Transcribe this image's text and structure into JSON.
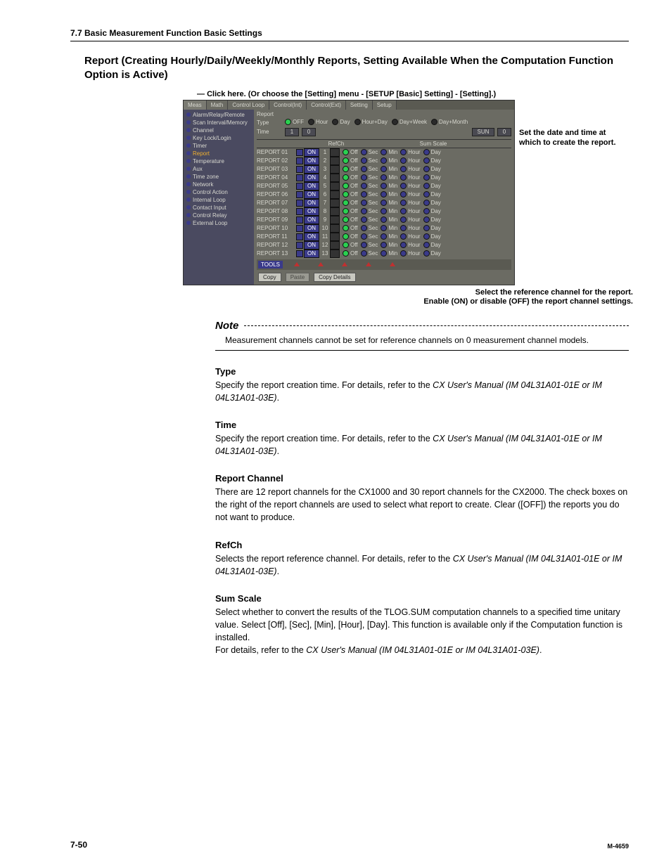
{
  "header": "7.7  Basic Measurement Function Basic Settings",
  "title": "Report (Creating Hourly/Daily/Weekly/Monthly Reports, Setting Available When the Computation Function Option is Active)",
  "click_here": "Click here. (Or choose the [Setting] menu - [SETUP [Basic] Setting] - [Setting].)",
  "right_annot": "Set the date and time at which to create the report.",
  "below_annot_1": "Select the reference channel for the report.",
  "below_annot_2": "Enable (ON) or disable (OFF) the report channel settings.",
  "note_head": "Note",
  "note_body": "Measurement channels cannot be set for reference channels on 0 measurement channel models.",
  "sect_type_h": "Type",
  "sect_type_p1": "Specify the report creation time. For details, refer to the ",
  "sect_type_it": "CX User's Manual (IM 04L31A01-01E or IM 04L31A01-03E)",
  "sect_type_p2": ".",
  "sect_time_h": "Time",
  "sect_time_p1": "Specify the report creation time.  For details, refer to the ",
  "sect_time_it": "CX User's Manual (IM 04L31A01-01E or IM 04L31A01-03E)",
  "sect_time_p2": ".",
  "sect_rc_h": "Report Channel",
  "sect_rc_p": "There are 12 report channels for the CX1000 and 30 report channels for the CX2000.  The check boxes on the right of the report channels are used to select what report to create.  Clear ([OFF]) the reports you do not want to produce.",
  "sect_ref_h": "RefCh",
  "sect_ref_p1": "Selects the report reference channel.  For details, refer to the ",
  "sect_ref_it": "CX User's Manual (IM 04L31A01-01E or IM 04L31A01-03E)",
  "sect_ref_p2": ".",
  "sect_sum_h": "Sum Scale",
  "sect_sum_p1": "Select whether to convert the results of the TLOG.SUM computation channels to a specified time unitary value.  Select [Off], [Sec], [Min], [Hour], [Day].  This function is available only if the Computation function is installed.",
  "sect_sum_p2a": "For details, refer to the ",
  "sect_sum_it": "CX User's Manual (IM 04L31A01-01E or IM 04L31A01-03E)",
  "sect_sum_p2b": ".",
  "page_num": "7-50",
  "manual_num": "M-4659",
  "shot": {
    "tabs": [
      "Meas",
      "Math",
      "Control Loop",
      "Control(Int)",
      "Control(Ext)",
      "Setting",
      "Setup"
    ],
    "active_tab": 0,
    "sidebar": [
      "Alarm/Relay/Remote",
      "Scan Interval/Memory",
      "Channel",
      "Key Lock/Login",
      "Timer",
      "Report",
      "Temperature",
      "Aux",
      "Time zone",
      "Network",
      "Control Action",
      "Internal Loop",
      "Contact Input",
      "Control Relay",
      "External Loop"
    ],
    "sidebar_selected": 5,
    "report_label": "Report",
    "type_label": "Type",
    "type_options": [
      "OFF",
      "Hour",
      "Day",
      "Hour+Day",
      "Day+Week",
      "Day+Month"
    ],
    "type_selected": 0,
    "time_label": "Time",
    "time_h": "1",
    "time_m": "0",
    "time_day": "SUN",
    "time_dnum": "0",
    "col_refch": "RefCh",
    "col_sum": "Sum Scale",
    "sum_opts": [
      "Off",
      "Sec",
      "Min",
      "Hour",
      "Day"
    ],
    "on_label": "ON",
    "rows": [
      {
        "name": "REPORT 01",
        "num": "1"
      },
      {
        "name": "REPORT 02",
        "num": "2"
      },
      {
        "name": "REPORT 03",
        "num": "3"
      },
      {
        "name": "REPORT 04",
        "num": "4"
      },
      {
        "name": "REPORT 05",
        "num": "5"
      },
      {
        "name": "REPORT 06",
        "num": "6"
      },
      {
        "name": "REPORT 07",
        "num": "7"
      },
      {
        "name": "REPORT 08",
        "num": "8"
      },
      {
        "name": "REPORT 09",
        "num": "9"
      },
      {
        "name": "REPORT 10",
        "num": "10"
      },
      {
        "name": "REPORT 11",
        "num": "11"
      },
      {
        "name": "REPORT 12",
        "num": "12"
      },
      {
        "name": "REPORT 13",
        "num": "13"
      }
    ],
    "tools_label": "TOOLS",
    "copy_btn": "Copy",
    "paste_btn": "Paste",
    "copydet_btn": "Copy Details"
  }
}
